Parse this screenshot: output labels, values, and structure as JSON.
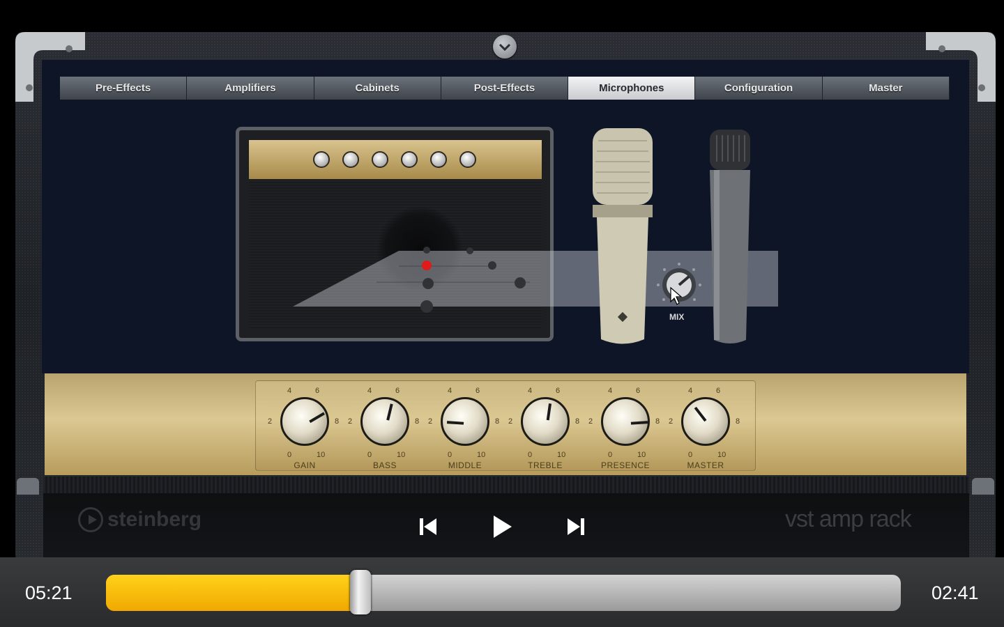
{
  "tabs": [
    {
      "label": "Pre-Effects",
      "active": false
    },
    {
      "label": "Amplifiers",
      "active": false
    },
    {
      "label": "Cabinets",
      "active": false
    },
    {
      "label": "Post-Effects",
      "active": false
    },
    {
      "label": "Microphones",
      "active": true
    },
    {
      "label": "Configuration",
      "active": false
    },
    {
      "label": "Master",
      "active": false
    }
  ],
  "mic": {
    "mix_label": "MIX"
  },
  "amp_knobs": [
    {
      "name": "GAIN",
      "scale": [
        "0",
        "2",
        "4",
        "6",
        "8",
        "10"
      ],
      "value": 7.2
    },
    {
      "name": "BASS",
      "scale": [
        "0",
        "2",
        "4",
        "6",
        "8",
        "10"
      ],
      "value": 5.5
    },
    {
      "name": "MIDDLE",
      "scale": [
        "0",
        "2",
        "4",
        "6",
        "8",
        "10"
      ],
      "value": 1.8
    },
    {
      "name": "TREBLE",
      "scale": [
        "0",
        "2",
        "4",
        "6",
        "8",
        "10"
      ],
      "value": 5.3
    },
    {
      "name": "PRESENCE",
      "scale": [
        "0",
        "2",
        "4",
        "6",
        "8",
        "10"
      ],
      "value": 8.2
    },
    {
      "name": "MASTER",
      "scale": [
        "0",
        "2",
        "4",
        "6",
        "8",
        "10"
      ],
      "value": 3.6
    }
  ],
  "brand": {
    "company": "steinberg",
    "product": "vst amp rack"
  },
  "player": {
    "elapsed": "05:21",
    "remaining": "02:41",
    "progress": 0.32
  },
  "icons": {
    "previous": "skip-back-icon",
    "play": "play-icon",
    "next": "skip-forward-icon",
    "collapse": "chevron-down-icon"
  },
  "colors": {
    "progress_fill": "#ffc400",
    "panel_bg": "#0d1526",
    "amp_gold": "#d2bc84"
  }
}
